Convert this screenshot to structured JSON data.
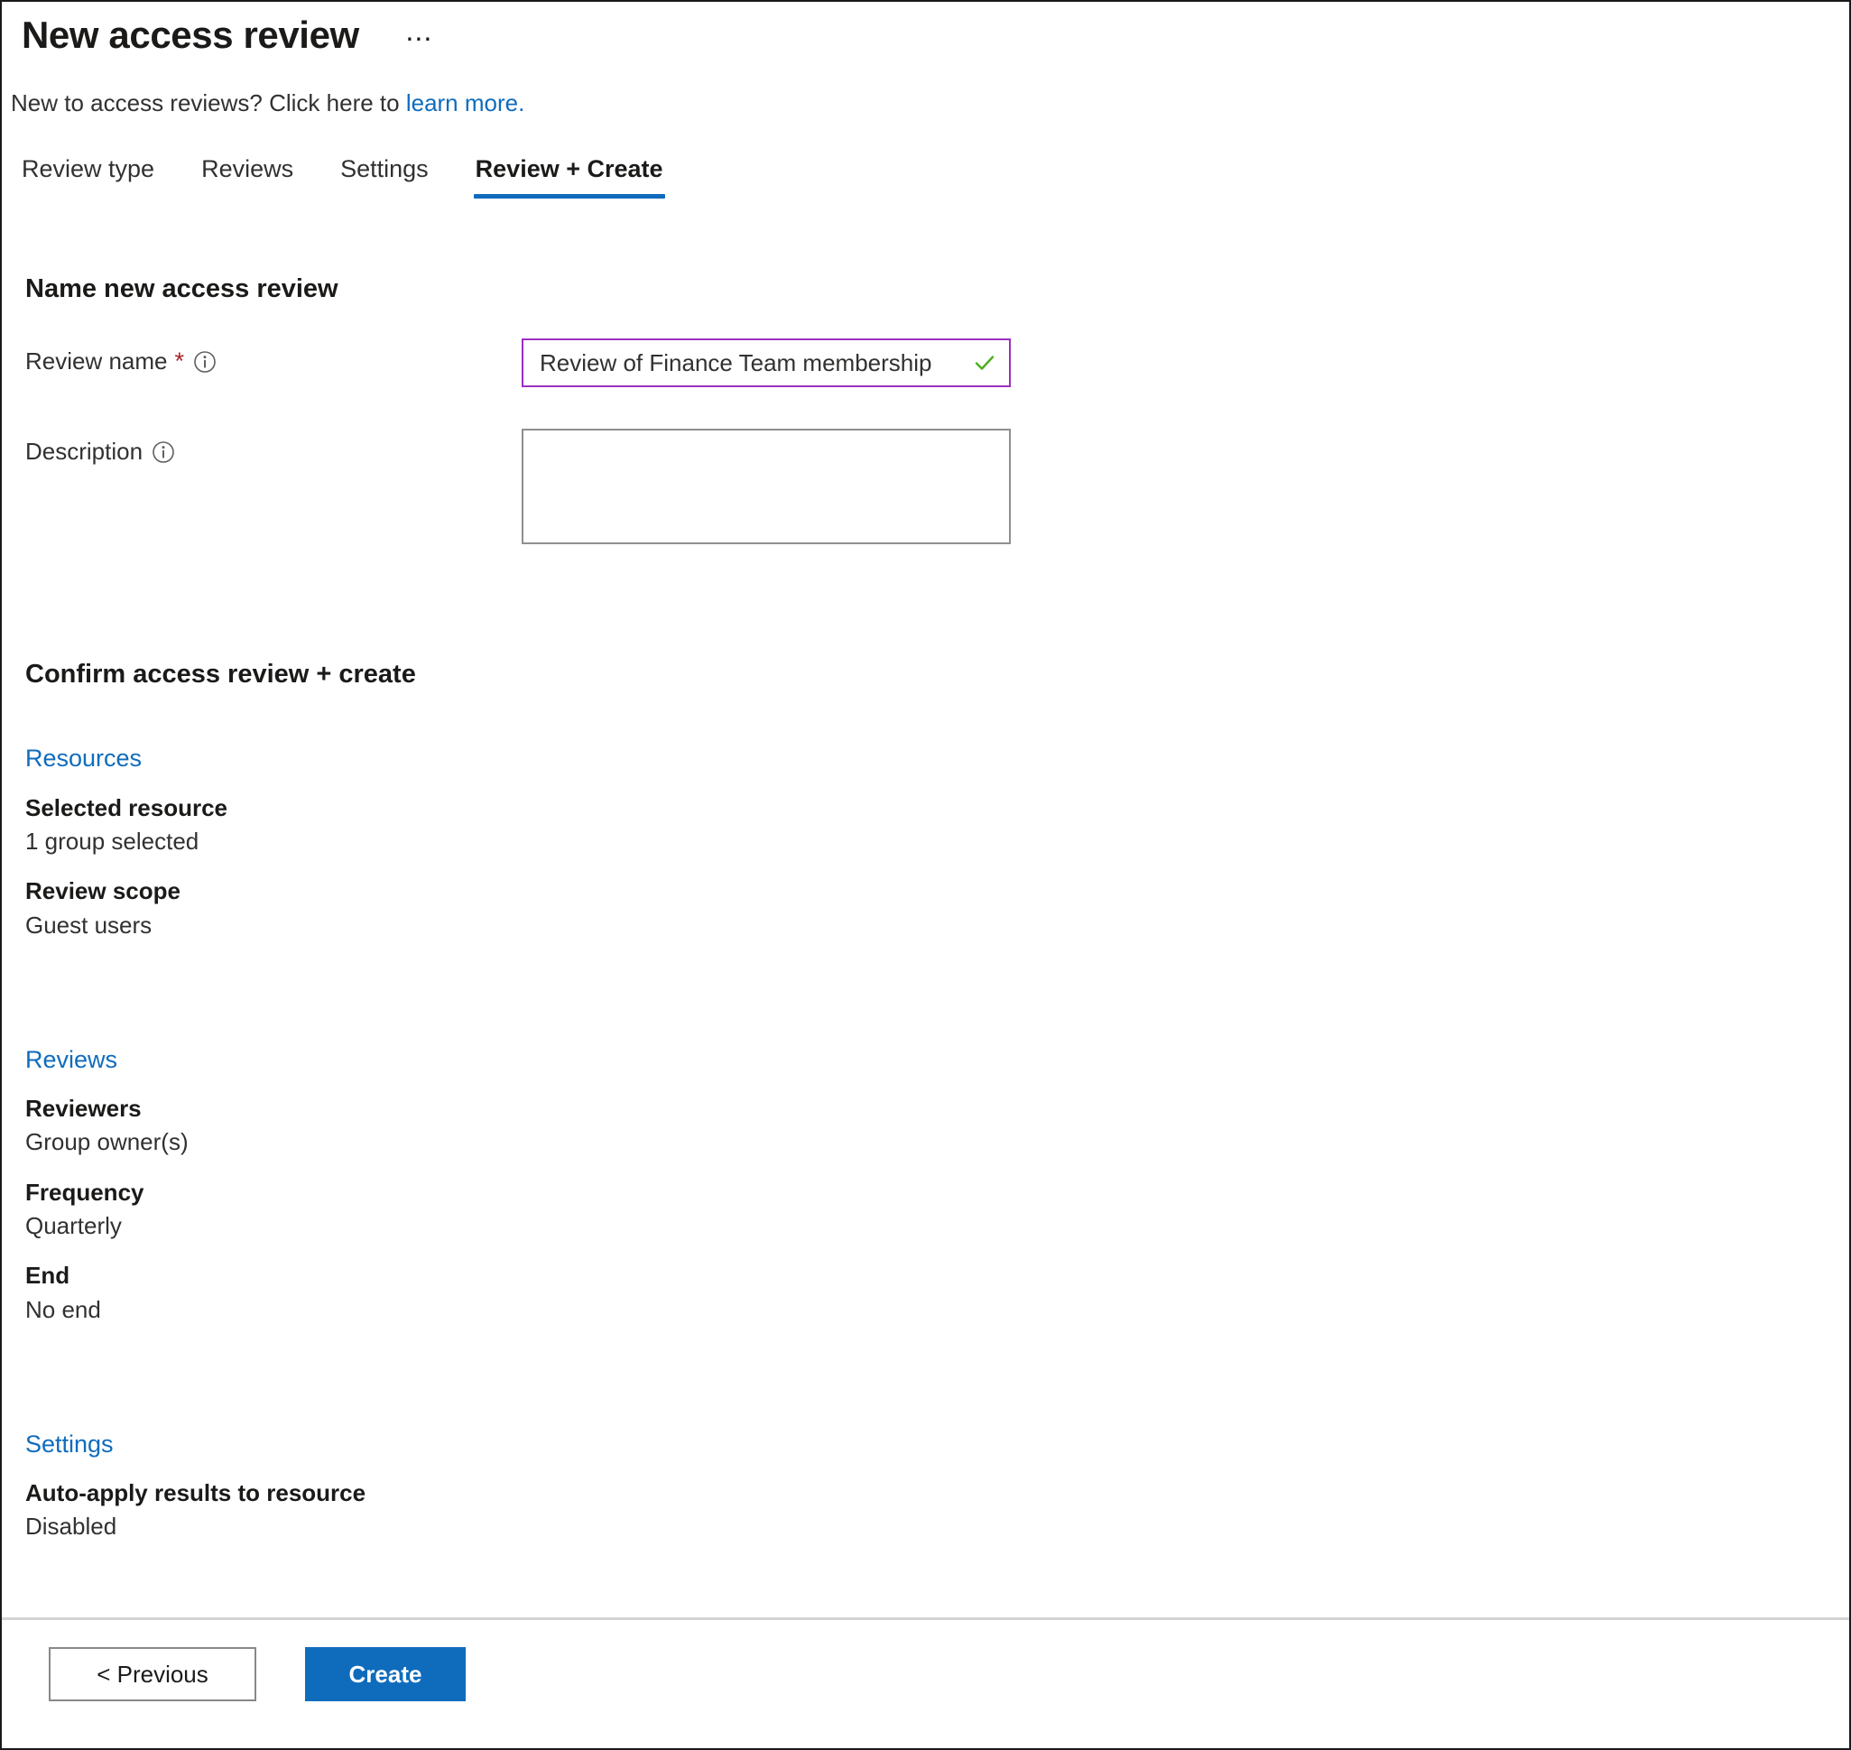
{
  "window": {
    "title": "New access review",
    "overflow_menu_label": "⋯"
  },
  "intro": {
    "text_before_link": "New to access reviews? Click here to ",
    "link_label": "learn more."
  },
  "tabs": [
    {
      "label": "Review type",
      "active": false
    },
    {
      "label": "Reviews",
      "active": false
    },
    {
      "label": "Settings",
      "active": false
    },
    {
      "label": "Review + Create",
      "active": true
    }
  ],
  "name_section": {
    "heading": "Name new access review",
    "review_name": {
      "label": "Review name",
      "required_marker": "*",
      "value": "Review of Finance Team membership",
      "valid": true
    },
    "description": {
      "label": "Description",
      "value": "",
      "placeholder": ""
    }
  },
  "confirm_section": {
    "heading": "Confirm access review + create",
    "groups": [
      {
        "link_label": "Resources",
        "items": [
          {
            "key": "Selected resource",
            "value": "1 group selected"
          },
          {
            "key": "Review scope",
            "value": "Guest users"
          }
        ]
      },
      {
        "link_label": "Reviews",
        "items": [
          {
            "key": "Reviewers",
            "value": "Group owner(s)"
          },
          {
            "key": "Frequency",
            "value": "Quarterly"
          },
          {
            "key": "End",
            "value": "No end"
          }
        ]
      },
      {
        "link_label": "Settings",
        "items": [
          {
            "key": "Auto-apply results to resource",
            "value": "Disabled"
          }
        ]
      }
    ]
  },
  "footer": {
    "previous_label": "< Previous",
    "create_label": "Create"
  },
  "colors": {
    "accent_blue": "#0f6cbd",
    "link_blue": "#0f6cbd",
    "input_focus_purple": "#9b30c4",
    "valid_green": "#498205",
    "required_red": "#a4262c",
    "text_primary": "#1b1a19",
    "text_secondary": "#323130",
    "divider": "#d4d4d4"
  },
  "icons": {
    "info": "info-icon",
    "check": "check-icon",
    "ellipsis": "ellipsis-icon"
  }
}
